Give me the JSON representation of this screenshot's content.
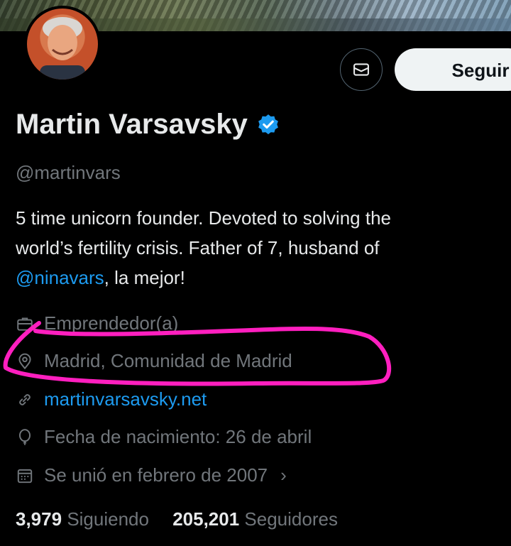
{
  "profile": {
    "name": "Martin Varsavsky",
    "handle": "@martinvars",
    "bio_line1": "5 time unicorn founder. Devoted to solving the",
    "bio_line2": "world’s fertility crisis. Father of 7, husband of",
    "bio_mention": "@ninavars",
    "bio_tail": ", la mejor!"
  },
  "actions": {
    "message_icon": "envelope-icon",
    "follow_label": "Seguir"
  },
  "meta": {
    "profession": "Emprendedor(a)",
    "location": "Madrid, Comunidad de Madrid",
    "website": "martinvarsavsky.net",
    "birthday": "Fecha de nacimiento: 26 de abril",
    "joined": "Se unió en febrero de 2007",
    "joined_chevron": "›"
  },
  "stats": {
    "following_count": "3,979",
    "following_label": "Siguiendo",
    "followers_count": "205,201",
    "followers_label": "Seguidores"
  },
  "colors": {
    "accent": "#1d9bf0",
    "annotation": "#ff1fbf"
  }
}
